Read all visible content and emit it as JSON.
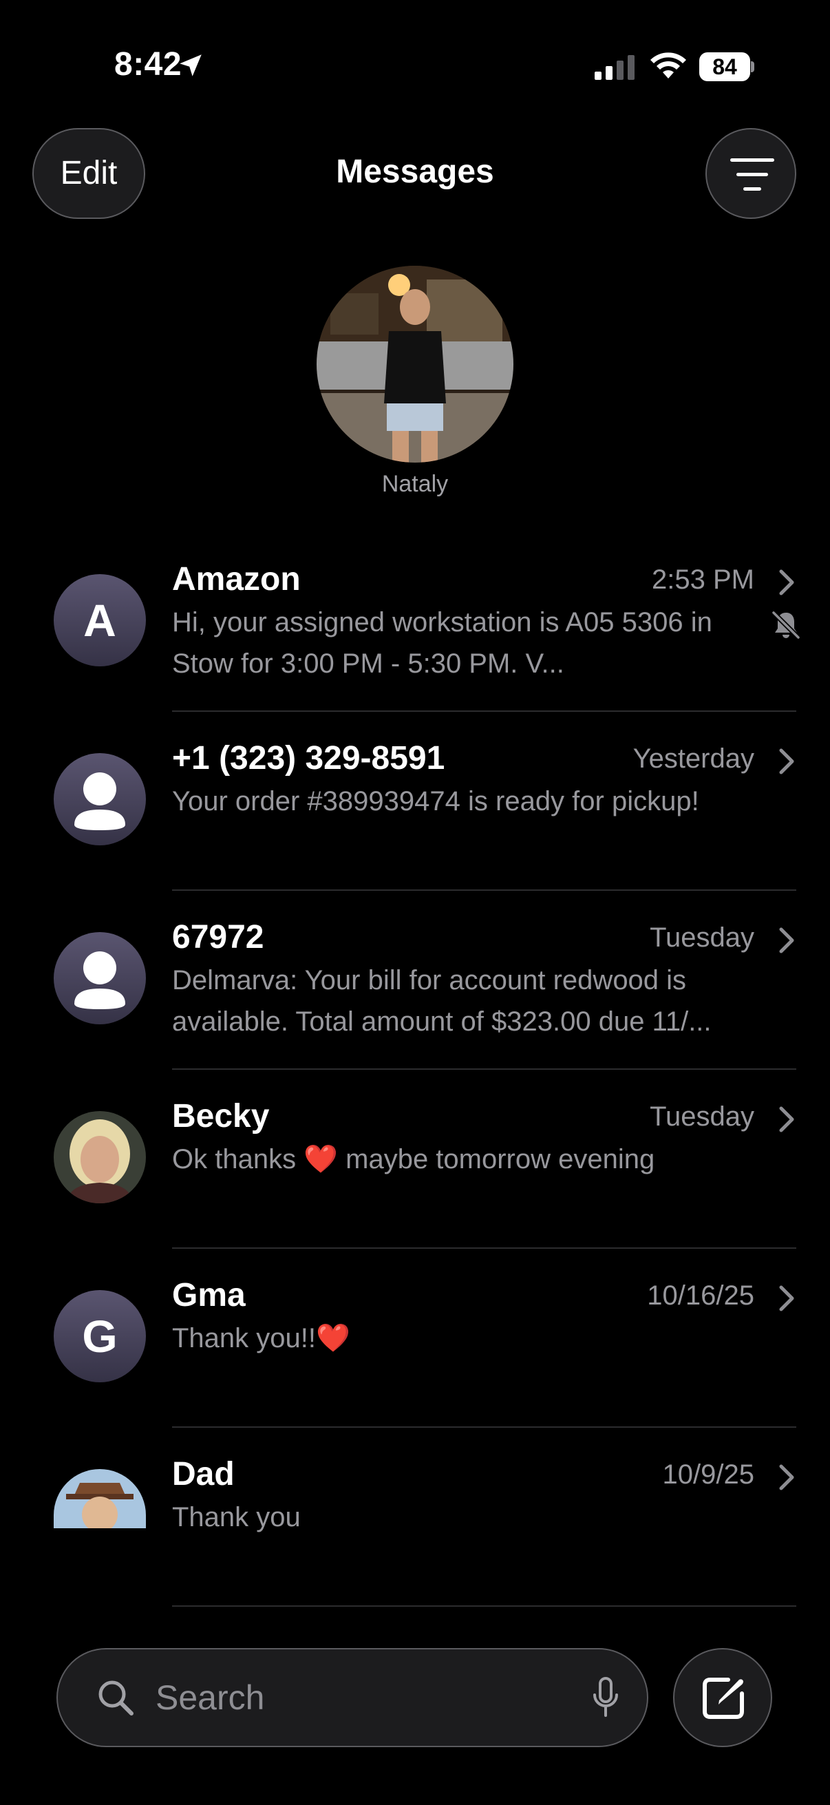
{
  "status_bar": {
    "time": "8:42",
    "battery": "84",
    "location_icon": "location-arrow-icon",
    "signal_icon": "cellular-signal-icon",
    "wifi_icon": "wifi-icon"
  },
  "header": {
    "edit_label": "Edit",
    "title": "Messages",
    "filter_icon": "filter-icon"
  },
  "pinned": {
    "name": "Nataly"
  },
  "conversations": [
    {
      "name": "Amazon",
      "time": "2:53 PM",
      "avatar": "A",
      "preview": "Hi, your assigned workstation is A05 5306 in Stow for 3:00 PM - 5:30 PM.  V...",
      "muted": true
    },
    {
      "name": "+1 (323) 329-8591",
      "time": "Yesterday",
      "avatar": "person-icon",
      "preview": "Your order #389939474 is ready for pickup!"
    },
    {
      "name": "67972",
      "time": "Tuesday",
      "avatar": "person-icon",
      "preview": "Delmarva: Your bill for account redwood is available. Total amount of $323.00 due 11/..."
    },
    {
      "name": "Becky",
      "time": "Tuesday",
      "avatar": "photo",
      "preview_before": "Ok thanks ",
      "preview_emoji": "❤️",
      "preview_after": " maybe tomorrow evening"
    },
    {
      "name": "Gma",
      "time": "10/16/25",
      "avatar": "G",
      "preview_before": "Thank you!!",
      "preview_emoji": "❤️"
    },
    {
      "name": "Dad",
      "time": "10/9/25",
      "avatar": "photo",
      "preview": "Thank you"
    }
  ],
  "search": {
    "placeholder": "Search",
    "search_icon": "search-icon",
    "mic_icon": "microphone-icon"
  },
  "compose": {
    "icon": "compose-icon"
  },
  "colors": {
    "background": "#000000",
    "secondary_text": "#98989d",
    "divider": "#2c2c2e",
    "avatar_fill": "#4a4660",
    "heart": "#e2262f"
  }
}
